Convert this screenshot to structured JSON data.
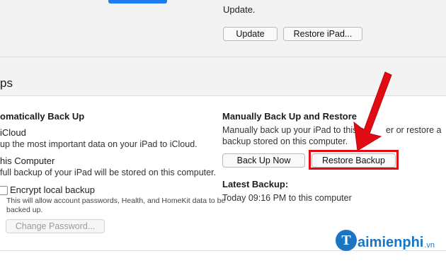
{
  "top": {
    "update_text": "Update.",
    "update_button": "Update",
    "restore_ipad_button": "Restore iPad..."
  },
  "section": {
    "title": "ps"
  },
  "left": {
    "heading": "omatically Back Up",
    "icloud_label": "iCloud",
    "icloud_desc": "up the most important data on your iPad to iCloud.",
    "computer_label": "his Computer",
    "computer_desc": "full backup of your iPad will be stored on this computer.",
    "encrypt_label": "Encrypt local backup",
    "encrypt_desc_1": "This will allow account passwords, Health, and HomeKit data to be",
    "encrypt_desc_2": "backed up.",
    "change_password_button": "Change Password..."
  },
  "right": {
    "heading": "Manually Back Up and Restore",
    "desc_line1": "Manually back up your iPad to this co",
    "desc_line1_end": "er or restore a",
    "desc_line2": "backup stored on this computer.",
    "back_up_now_button": "Back Up Now",
    "restore_backup_button": "Restore Backup",
    "latest_backup_label": "Latest Backup:",
    "latest_backup_value": "Today 09:16 PM to this computer"
  },
  "watermark": {
    "initial": "T",
    "name": "aimienphi",
    "tld": ".vn"
  },
  "colors": {
    "highlight": "#e30b13",
    "accent": "#1b7df0",
    "brand": "#1a76c2"
  }
}
